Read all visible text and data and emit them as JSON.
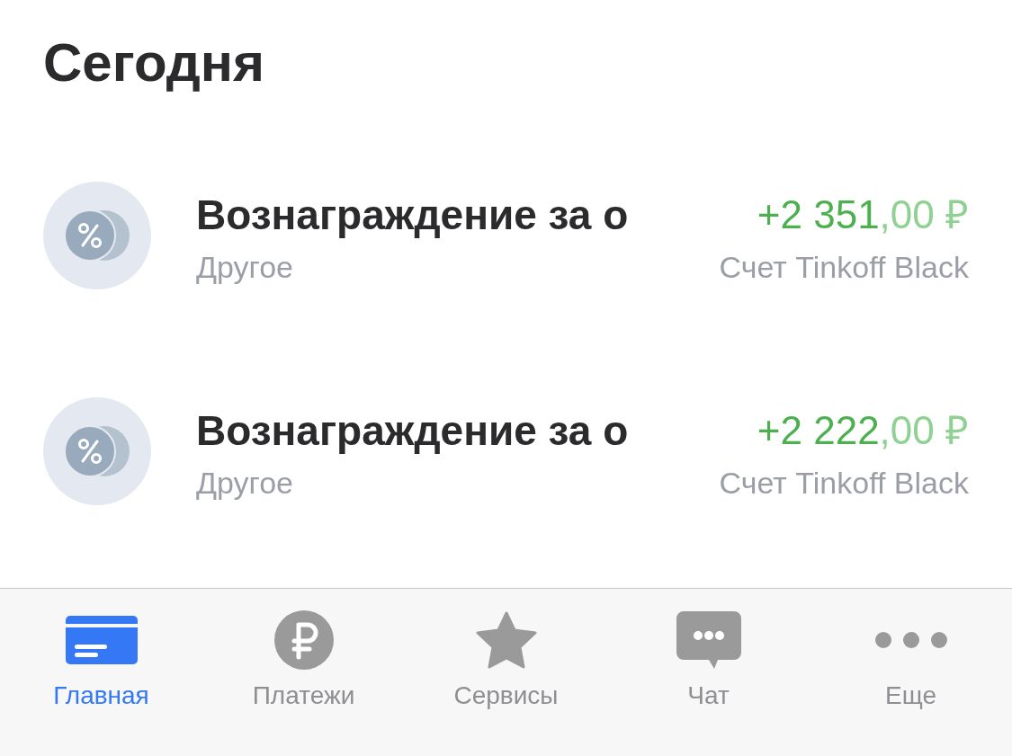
{
  "header": {
    "title": "Сегодня"
  },
  "operations": [
    {
      "title": "Вознаграждение за о",
      "category": "Другое",
      "amount": "+2 351",
      "amount_cents": ",00 ₽",
      "account": "Счет Tinkoff Black"
    },
    {
      "title": "Вознаграждение за о",
      "category": "Другое",
      "amount": "+2 222",
      "amount_cents": ",00 ₽",
      "account": "Счет Tinkoff Black"
    }
  ],
  "tab_bar": [
    {
      "kind": "card",
      "label": "Главная",
      "selected": true
    },
    {
      "kind": "ruble",
      "label": "Платежи",
      "selected": false
    },
    {
      "kind": "star",
      "label": "Сервисы",
      "selected": false
    },
    {
      "kind": "chat",
      "label": "Чат",
      "selected": false
    },
    {
      "kind": "more",
      "label": "Еще",
      "selected": false
    }
  ]
}
